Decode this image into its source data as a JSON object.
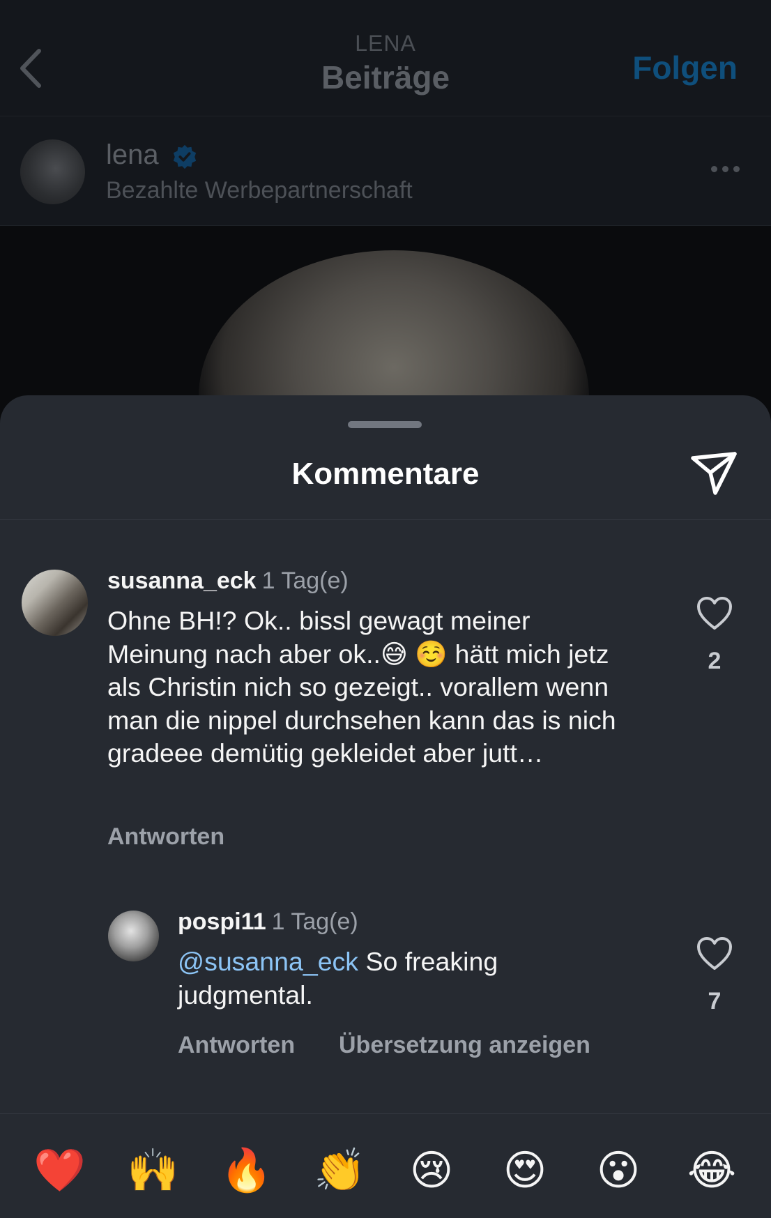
{
  "header": {
    "account_label": "LENA",
    "title": "Beiträge",
    "follow_label": "Folgen"
  },
  "post": {
    "author": "lena",
    "subtitle": "Bezahlte Werbepartnerschaft"
  },
  "sheet": {
    "title": "Kommentare"
  },
  "comments": [
    {
      "username": "susanna_eck",
      "time": "1 Tag(e)",
      "text": "Ohne BH!? Ok.. bissl gewagt meiner Meinung nach aber ok..😅 ☺️  hätt mich jetz als Christin nich so gezeigt.. vorallem wenn man die nippel durchsehen kann das is nich gradeee demütig gekleidet aber jutt…",
      "likes": "2",
      "reply_label": "Antworten"
    },
    {
      "username": "pospi11",
      "time": "1 Tag(e)",
      "mention": "@susanna_eck",
      "text": " So freaking judgmental.",
      "likes": "7",
      "reply_label": "Antworten",
      "translate_label": "Übersetzung anzeigen"
    }
  ],
  "quick_reactions": [
    "❤️",
    "🙌",
    "🔥",
    "👏",
    "😢",
    "😍",
    "😮",
    "😂"
  ],
  "colors": {
    "follow_blue": "#0f4f7c",
    "mention_blue": "#8cc4f5",
    "sheet_bg": "#262a31"
  }
}
